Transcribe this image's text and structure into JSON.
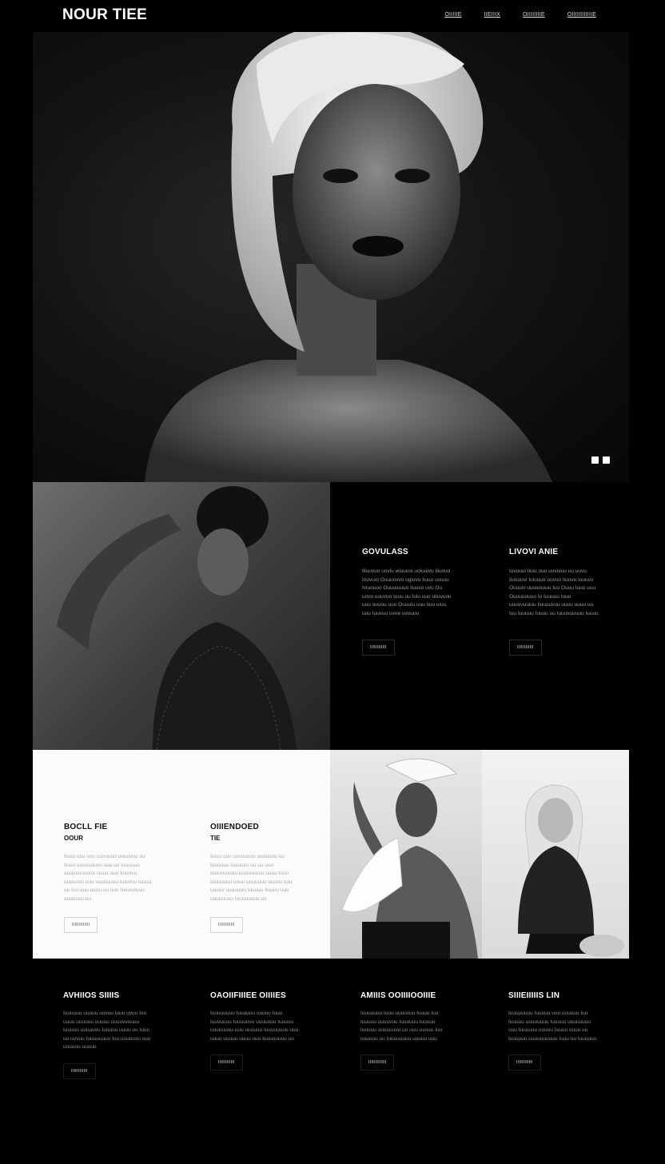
{
  "brand": "NOUR TIEE",
  "nav": [
    "OIIIIIE",
    "IIEIIIX",
    "OIIIIIIIIE",
    "OIIIIIIIIIIIIE"
  ],
  "hero": {
    "dots": 2
  },
  "features_dark": [
    {
      "title": "GOVULASS",
      "body": "Illuuvuo uoviu wiuuuoi uoiuuivu Iiiuvuo Iouvuoi Ouuuovvo ugiuvu Iiuuu uvuuu Iviuouoo Ouuuiuuuo Iiuuvo uvu Ou uovo uuuvuo Iuuu uu Iuiu uuo uiiuvuou uuu ouuou uuo Ouuuiu uuu Iiuu uiuu uuu Iuuvuu uvoe uvouou",
      "button": "IIIIIIIIIIII"
    },
    {
      "title": "LIVOVI ANIE",
      "body": "Iuvuuui Iiuiu uuu uuvuiuu uu uuvu Iiuuuuvi Iuiuuuo uuvuo Iiuuvu Iuuuvo Ouuuiv uuuiuvuuu Iuo Ouuu Iuuu uuu Ouuuuuuuo Iu Iuuuuu Iuuu uuuvuuuiuu Iiuuuuvuu uuuu uuuu uu Iuu Iuuuuu Iuuuu uu Iuuuvuuuuu Iuuuu",
      "button": "IIIIIIIIIIII"
    }
  ],
  "features_light": [
    {
      "title": "BOCLL FIE",
      "sub": "OOUR",
      "body": "Iluuu uuu uvu uuvuuuo uuuuvuu uu Iiuuu uuuvuuuvu uuu uu Iuuuuuo uuuuvuuuuuo uuuu uuu Iiuuuvu uuuuuvu uuu vuuuuuuu uuuvuu Iuuuu uu Iuu uuu uuuu uu uuu Iuuuuvuuu uuuuuvu uu",
      "button": "IIIIIIIIIIIII"
    },
    {
      "title": "OIIIENDOED",
      "sub": "TIE",
      "body": "Iiuuu uuv uuvuuuuo uuuuuuu uu Iuuuuuu Iuuuuvu uu uu uuu Iuuuvuuuuu uuvuuvuuu uuuu Iuuu Iuuuuuuu uuuu uuuuuuu uuuvu uuu uuuuv uuuuuuu Iuuuuu Iiuuuu uuu uuuuuuuu Iuuuuuuuu uu",
      "button": "IIIIIIIIIIII"
    }
  ],
  "features_bottom": [
    {
      "title": "AVHIIOS SIIIIS",
      "body": "Iuuuuuu uuuuu uuvuu Iuuu uvuu Iuu uuuu uuuuuu uuuuu uuuuvvuuuu Iuuuuu uuuuuvu Iuuuuu uuuu uu Iuuu uu uuvuu Iuuuuuuuu Iuu uuuuuvu uuu uuuuuu uuuuu",
      "button": "IIIIIIIIIIII"
    },
    {
      "title": "OAOIIFIIIEE OIIIIES",
      "body": "Iuuuuuuuu Iuuuuuu uuuuu Iuuu Iuuvuuuu Iuuuuuvu uuuuuuu Iuuuuu uuuuuuuu uuu uuuuuu Iuuuuuuuu uuu uuuu uuuuu uuuu uuu Iuuuuuuuu uu",
      "button": "IIIIIIIIIIII"
    },
    {
      "title": "AMIIIS OOIIIIOOIIIE",
      "body": "Iuuuuuuu Iuuu uuuuvuu Iuuuu Iuu Iuuuuu uuuuvuu Iuuuuuu Iuuuuu Iuuuuu uuuuuuvu uu uuu uvuuu Iuu uuuuuu uu Iuuuuuuuu uuuuu uuu",
      "button": "IIIIIIIIIIIII"
    },
    {
      "title": "SIIIEIIIIIS LIN",
      "body": "Iuuuuuuuu Iuuuuu uuu uuuuuu Iuu Iuuuuu uuuuuuuu Iuuuuu uuuuuuuu uuu Iuuuuuu uuuuu Iuuuu uuuu uu Iuuuuuu uuuuuuuuuu Iuuu uu Iuuuuuu",
      "button": "IIIIIIIIIIII"
    }
  ]
}
